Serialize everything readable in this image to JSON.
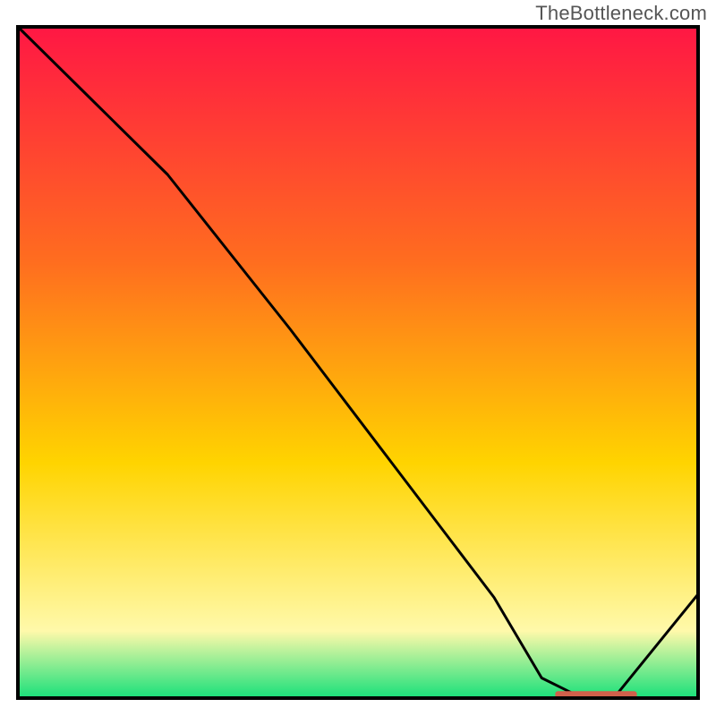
{
  "attribution": "TheBottleneck.com",
  "chart_data": {
    "type": "line",
    "title": "",
    "xlabel": "",
    "ylabel": "",
    "xlim": [
      0,
      100
    ],
    "ylim": [
      0,
      100
    ],
    "grid": false,
    "series": [
      {
        "name": "curve",
        "x": [
          0,
          10,
          22,
          40,
          55,
          70,
          77,
          82,
          88,
          100
        ],
        "values": [
          100,
          90,
          78,
          55,
          35,
          15,
          3,
          0.5,
          0.5,
          15.5
        ]
      }
    ],
    "gradient_colors": {
      "top": "#ff1744",
      "mid1": "#ff6d1f",
      "mid2": "#ffd400",
      "lower": "#fff9aa",
      "bottom": "#18e07a"
    },
    "marker": {
      "x_center": 85,
      "y_value": 0.5,
      "width": 12,
      "color": "#d1604b"
    },
    "line_color": "#000000",
    "frame_color": "#000000"
  }
}
